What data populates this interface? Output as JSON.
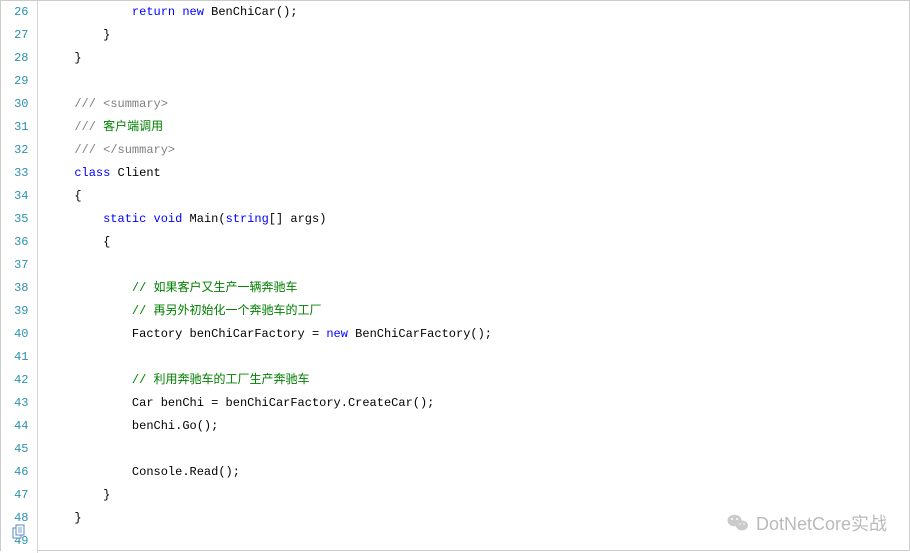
{
  "lines": [
    {
      "num": "26",
      "indent": "            ",
      "tokens": [
        {
          "t": "return",
          "c": "kw"
        },
        {
          "t": " ",
          "c": ""
        },
        {
          "t": "new",
          "c": "new-kw"
        },
        {
          "t": " BenChiCar();",
          "c": ""
        }
      ]
    },
    {
      "num": "27",
      "indent": "        ",
      "tokens": [
        {
          "t": "}",
          "c": ""
        }
      ]
    },
    {
      "num": "28",
      "indent": "    ",
      "tokens": [
        {
          "t": "}",
          "c": ""
        }
      ]
    },
    {
      "num": "29",
      "indent": "",
      "tokens": []
    },
    {
      "num": "30",
      "indent": "    ",
      "tokens": [
        {
          "t": "/// <summary>",
          "c": "doc-comment"
        }
      ]
    },
    {
      "num": "31",
      "indent": "    ",
      "tokens": [
        {
          "t": "/// ",
          "c": "doc-comment"
        },
        {
          "t": "客户端调用",
          "c": "comment"
        }
      ]
    },
    {
      "num": "32",
      "indent": "    ",
      "tokens": [
        {
          "t": "/// </summary>",
          "c": "doc-comment"
        }
      ]
    },
    {
      "num": "33",
      "indent": "    ",
      "tokens": [
        {
          "t": "class",
          "c": "class-kw"
        },
        {
          "t": " Client",
          "c": ""
        }
      ]
    },
    {
      "num": "34",
      "indent": "    ",
      "tokens": [
        {
          "t": "{",
          "c": ""
        }
      ]
    },
    {
      "num": "35",
      "indent": "        ",
      "tokens": [
        {
          "t": "static",
          "c": "kw"
        },
        {
          "t": " ",
          "c": ""
        },
        {
          "t": "void",
          "c": "kw"
        },
        {
          "t": " Main(",
          "c": ""
        },
        {
          "t": "string",
          "c": "kw"
        },
        {
          "t": "[] args)",
          "c": ""
        }
      ]
    },
    {
      "num": "36",
      "indent": "        ",
      "tokens": [
        {
          "t": "{",
          "c": ""
        }
      ]
    },
    {
      "num": "37",
      "indent": "",
      "tokens": []
    },
    {
      "num": "38",
      "indent": "            ",
      "tokens": [
        {
          "t": "// 如果客户又生产一辆奔驰车",
          "c": "comment"
        }
      ]
    },
    {
      "num": "39",
      "indent": "            ",
      "tokens": [
        {
          "t": "// 再另外初始化一个奔驰车的工厂",
          "c": "comment"
        }
      ]
    },
    {
      "num": "40",
      "indent": "            ",
      "tokens": [
        {
          "t": "Factory benChiCarFactory = ",
          "c": ""
        },
        {
          "t": "new",
          "c": "new-kw"
        },
        {
          "t": " BenChiCarFactory();",
          "c": ""
        }
      ]
    },
    {
      "num": "41",
      "indent": "",
      "tokens": []
    },
    {
      "num": "42",
      "indent": "            ",
      "tokens": [
        {
          "t": "// 利用奔驰车的工厂生产奔驰车",
          "c": "comment"
        }
      ]
    },
    {
      "num": "43",
      "indent": "            ",
      "tokens": [
        {
          "t": "Car benChi = benChiCarFactory.CreateCar();",
          "c": ""
        }
      ]
    },
    {
      "num": "44",
      "indent": "            ",
      "tokens": [
        {
          "t": "benChi.Go();",
          "c": ""
        }
      ]
    },
    {
      "num": "45",
      "indent": "",
      "tokens": []
    },
    {
      "num": "46",
      "indent": "            ",
      "tokens": [
        {
          "t": "Console.Read();",
          "c": ""
        }
      ]
    },
    {
      "num": "47",
      "indent": "        ",
      "tokens": [
        {
          "t": "}",
          "c": ""
        }
      ]
    },
    {
      "num": "48",
      "indent": "    ",
      "tokens": [
        {
          "t": "}",
          "c": ""
        }
      ]
    },
    {
      "num": "49",
      "indent": "",
      "tokens": []
    }
  ],
  "watermark": {
    "text": "DotNetCore实战"
  }
}
